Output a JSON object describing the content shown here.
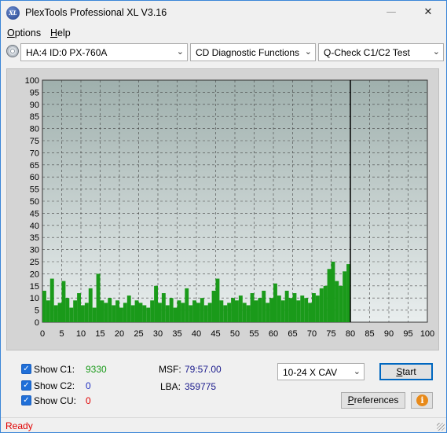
{
  "window": {
    "title": "PlexTools Professional XL V3.16",
    "icon_text": "XL",
    "minimize_glyph": "—",
    "maximize_glyph": "☐",
    "close_glyph": "✕"
  },
  "menu": {
    "options_accel": "O",
    "options_rest": "ptions",
    "help_accel": "H",
    "help_rest": "elp"
  },
  "toolbar": {
    "drive": "HA:4 ID:0  PX-760A",
    "function": "CD Diagnostic Functions",
    "test": "Q-Check C1/C2 Test",
    "arrow": "⌄"
  },
  "controls": {
    "show_c1_label": "Show C1:",
    "show_c1_value": "9330",
    "show_c2_label": "Show C2:",
    "show_c2_value": "0",
    "show_cu_label": "Show CU:",
    "show_cu_value": "0",
    "check_glyph": "✓",
    "msf_label": "MSF:",
    "msf_value": "79:57.00",
    "lba_label": "LBA:",
    "lba_value": "359775",
    "speed": "10-24 X CAV",
    "start_accel": "S",
    "start_rest": "tart",
    "pref_accel": "P",
    "pref_rest": "references",
    "info_glyph": "i"
  },
  "status": {
    "text": "Ready"
  },
  "colors": {
    "c1": "#1a9a1a",
    "c2": "#2030c0",
    "cu": "#e00000",
    "plot_bg_top": "#9fb0ad",
    "plot_bg_bottom": "#e9eeee",
    "status": "#e00000"
  },
  "chart_data": {
    "type": "bar",
    "title": "",
    "xlabel": "",
    "ylabel": "",
    "xlim": [
      0,
      100
    ],
    "ylim": [
      0,
      100
    ],
    "x_ticks": [
      0,
      5,
      10,
      15,
      20,
      25,
      30,
      35,
      40,
      45,
      50,
      55,
      60,
      65,
      70,
      75,
      80,
      85,
      90,
      95,
      100
    ],
    "y_ticks": [
      0,
      5,
      10,
      15,
      20,
      25,
      30,
      35,
      40,
      45,
      50,
      55,
      60,
      65,
      70,
      75,
      80,
      85,
      90,
      95,
      100
    ],
    "end_marker_x": 80,
    "grid": true,
    "series": [
      {
        "color": "#1a9a1a",
        "x": [
          0.5,
          1.5,
          2.5,
          3.5,
          4.5,
          5.5,
          6.5,
          7.5,
          8.5,
          9.5,
          10.5,
          11.5,
          12.5,
          13.5,
          14.5,
          15.5,
          16.5,
          17.5,
          18.5,
          19.5,
          20.5,
          21.5,
          22.5,
          23.5,
          24.5,
          25.5,
          26.5,
          27.5,
          28.5,
          29.5,
          30.5,
          31.5,
          32.5,
          33.5,
          34.5,
          35.5,
          36.5,
          37.5,
          38.5,
          39.5,
          40.5,
          41.5,
          42.5,
          43.5,
          44.5,
          45.5,
          46.5,
          47.5,
          48.5,
          49.5,
          50.5,
          51.5,
          52.5,
          53.5,
          54.5,
          55.5,
          56.5,
          57.5,
          58.5,
          59.5,
          60.5,
          61.5,
          62.5,
          63.5,
          64.5,
          65.5,
          66.5,
          67.5,
          68.5,
          69.5,
          70.5,
          71.5,
          72.5,
          73.5,
          74.5,
          75.5,
          76.5,
          77.5,
          78.5,
          79.5
        ],
        "values": [
          13,
          9,
          18,
          7,
          8,
          17,
          10,
          6,
          9,
          12,
          7,
          8,
          14,
          6,
          20,
          9,
          8,
          10,
          7,
          9,
          6,
          8,
          11,
          7,
          9,
          8,
          7,
          6,
          9,
          15,
          8,
          12,
          7,
          10,
          6,
          9,
          8,
          14,
          7,
          9,
          8,
          10,
          7,
          8,
          13,
          18,
          9,
          7,
          8,
          10,
          9,
          11,
          8,
          7,
          12,
          9,
          10,
          13,
          8,
          10,
          16,
          11,
          9,
          13,
          10,
          12,
          9,
          11,
          10,
          8,
          12,
          11,
          14,
          15,
          22,
          25,
          17,
          15,
          21,
          24
        ]
      }
    ]
  }
}
